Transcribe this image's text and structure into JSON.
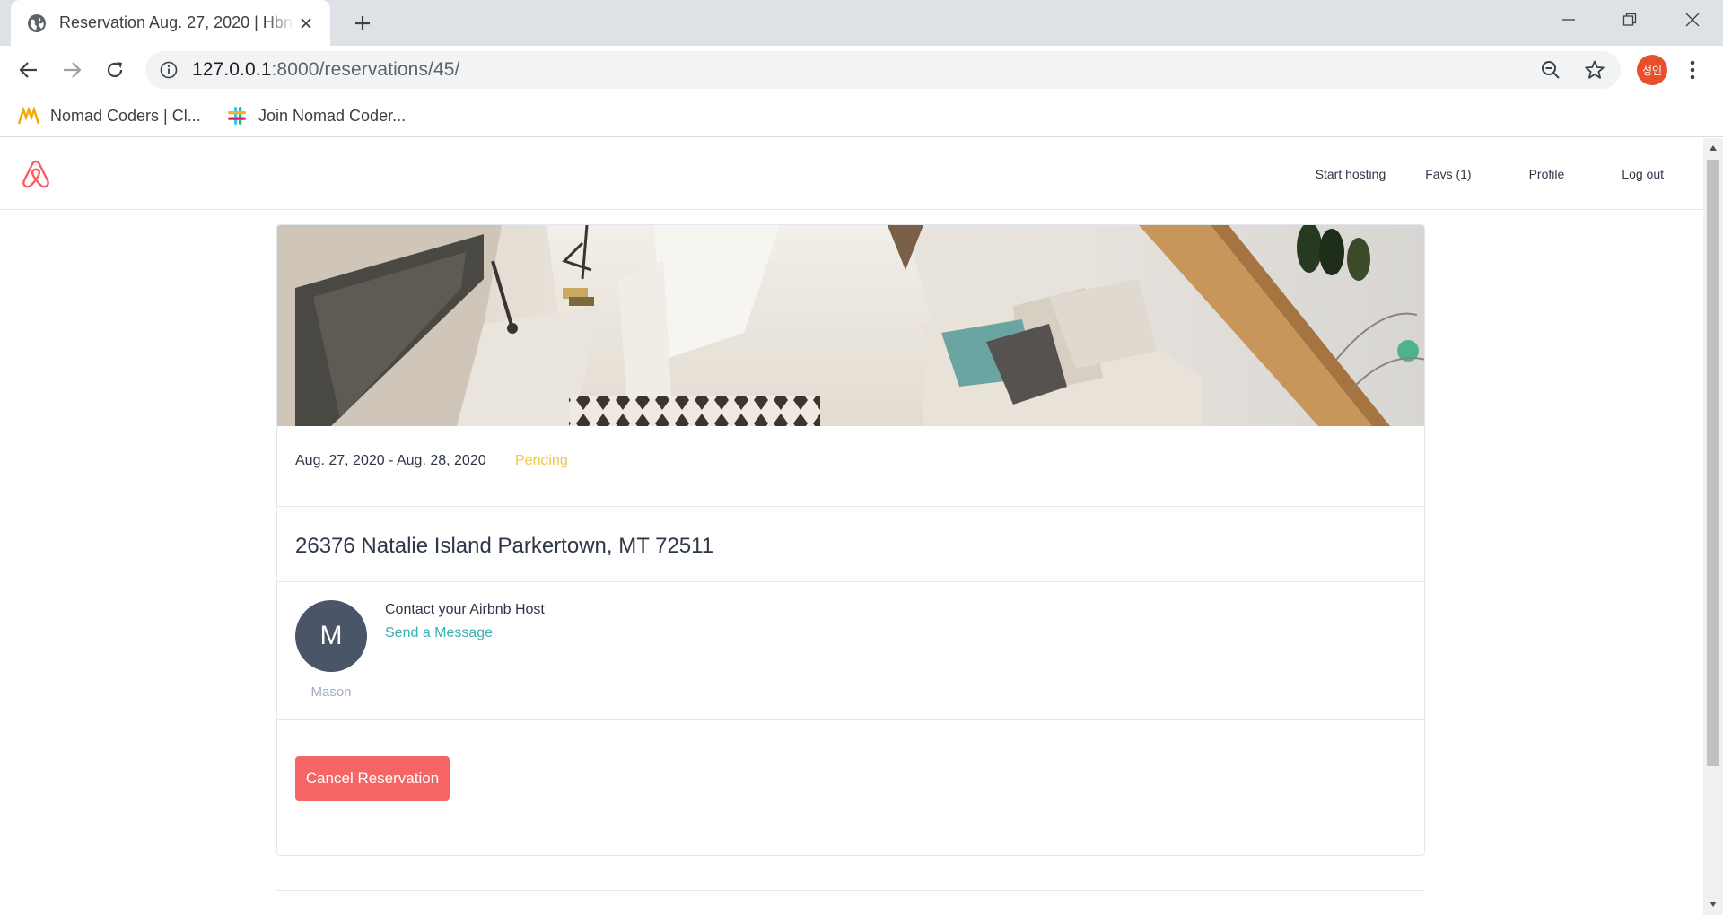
{
  "browser": {
    "tab_title": "Reservation Aug. 27, 2020 | Hbnb",
    "url_host": "127.0.0.1",
    "url_rest": ":8000/reservations/45/",
    "profile_initials": "성인",
    "bookmarks": [
      {
        "label": "Nomad Coders | Cl...",
        "icon": "nomad-logo-icon"
      },
      {
        "label": "Join Nomad Coder...",
        "icon": "slack-icon"
      }
    ]
  },
  "header": {
    "logo": "airbnb-logo-icon",
    "nav": {
      "start_hosting": "Start hosting",
      "favs": "Favs (1)",
      "profile": "Profile",
      "logout": "Log out"
    }
  },
  "reservation": {
    "dates": "Aug. 27, 2020 - Aug. 28, 2020",
    "status": "Pending",
    "status_color": "#ecc94b",
    "address": "26376 Natalie Island Parkertown, MT 72511",
    "host": {
      "initial": "M",
      "name": "Mason",
      "contact_title": "Contact your Airbnb Host",
      "contact_link": "Send a Message"
    },
    "cancel_label": "Cancel Reservation"
  },
  "colors": {
    "accent_teal": "#38b2ac",
    "cancel_red": "#f56565",
    "avatar_gray": "#4a5568"
  }
}
